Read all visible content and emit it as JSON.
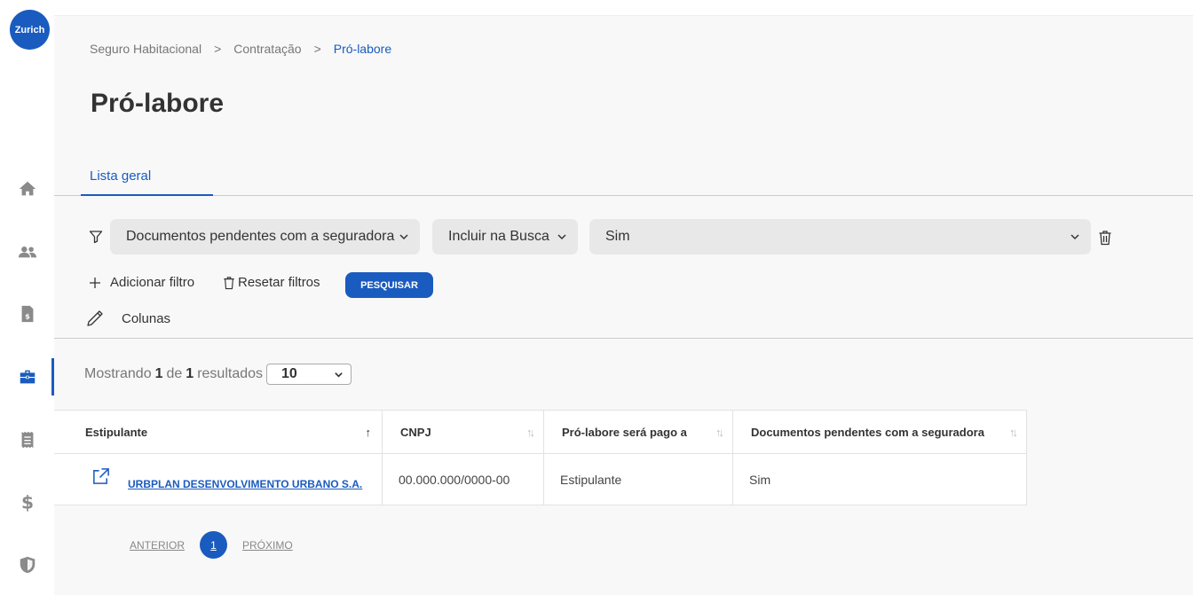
{
  "brand": {
    "logo_text": "Zurich",
    "accent": "#1a5bbf"
  },
  "sidebar": {
    "items": [
      {
        "icon": "home-icon",
        "active": false
      },
      {
        "icon": "users-icon",
        "active": false
      },
      {
        "icon": "invoice-icon",
        "active": false
      },
      {
        "icon": "briefcase-icon",
        "active": true
      },
      {
        "icon": "receipt-icon",
        "active": false
      },
      {
        "icon": "dollar-icon",
        "active": false
      },
      {
        "icon": "shield-icon",
        "active": false
      }
    ]
  },
  "breadcrumb": {
    "items": [
      "Seguro Habitacional",
      "Contratação",
      "Pró-labore"
    ],
    "separator": ">"
  },
  "page": {
    "title": "Pró-labore"
  },
  "tabs": [
    {
      "label": "Lista geral",
      "active": true
    }
  ],
  "filters": {
    "field": "Documentos pendentes com a seguradora",
    "operator": "Incluir na Busca",
    "value": "Sim"
  },
  "actions": {
    "add_filter": "Adicionar filtro",
    "reset_filters": "Resetar filtros",
    "search": "PESQUISAR",
    "columns": "Colunas"
  },
  "results": {
    "prefix": "Mostrando",
    "shown": "1",
    "of": "de",
    "total": "1",
    "suffix": "resultados",
    "page_size": "10"
  },
  "table": {
    "columns": [
      "Estipulante",
      "CNPJ",
      "Pró-labore será pago a",
      "Documentos pendentes com a seguradora"
    ],
    "rows": [
      {
        "estipulante": "URBPLAN DESENVOLVIMENTO URBANO S.A.",
        "cnpj": "00.000.000/0000-00",
        "pago_a": "Estipulante",
        "docs_pendentes": "Sim"
      }
    ]
  },
  "pagination": {
    "prev": "ANTERIOR",
    "current": "1",
    "next": "PRÓXIMO"
  }
}
